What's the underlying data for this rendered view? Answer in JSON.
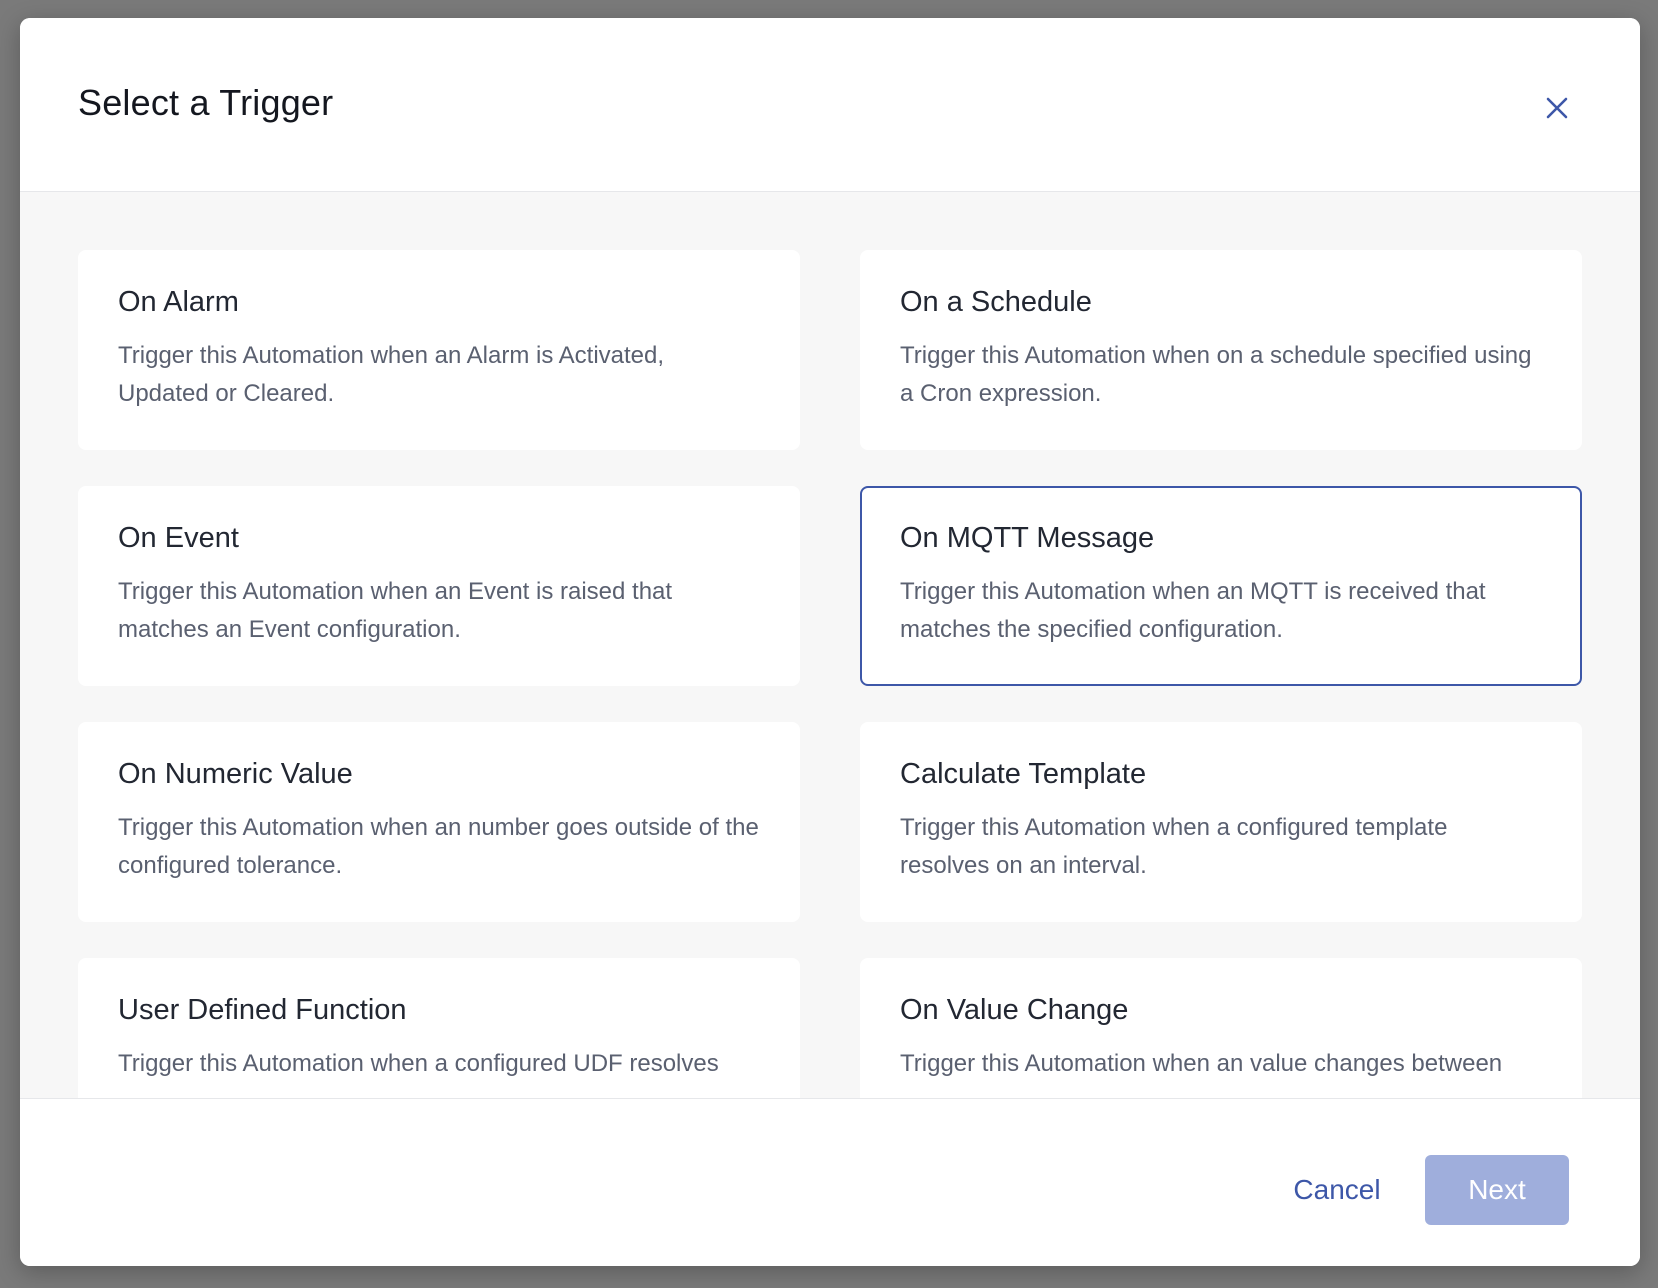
{
  "modal": {
    "title": "Select a Trigger",
    "close_icon": "close-icon",
    "accent_color": "#3d57a8"
  },
  "triggers": [
    {
      "title": "On Alarm",
      "description": "Trigger this Automation when an Alarm is Activated, Updated or Cleared.",
      "selected": false
    },
    {
      "title": "On a Schedule",
      "description": "Trigger this Automation when on a schedule specified using a Cron expression.",
      "selected": false
    },
    {
      "title": "On Event",
      "description": "Trigger this Automation when an Event is raised that matches an Event configuration.",
      "selected": false
    },
    {
      "title": "On MQTT Message",
      "description": "Trigger this Automation when an MQTT is received that matches the specified configuration.",
      "selected": true
    },
    {
      "title": "On Numeric Value",
      "description": "Trigger this Automation when an number goes outside of the configured tolerance.",
      "selected": false
    },
    {
      "title": "Calculate Template",
      "description": "Trigger this Automation when a configured template resolves on an interval.",
      "selected": false
    },
    {
      "title": "User Defined Function",
      "description": "Trigger this Automation when a configured UDF resolves",
      "selected": false
    },
    {
      "title": "On Value Change",
      "description": "Trigger this Automation when an value changes between",
      "selected": false
    }
  ],
  "footer": {
    "cancel_label": "Cancel",
    "next_label": "Next",
    "next_enabled": false
  }
}
